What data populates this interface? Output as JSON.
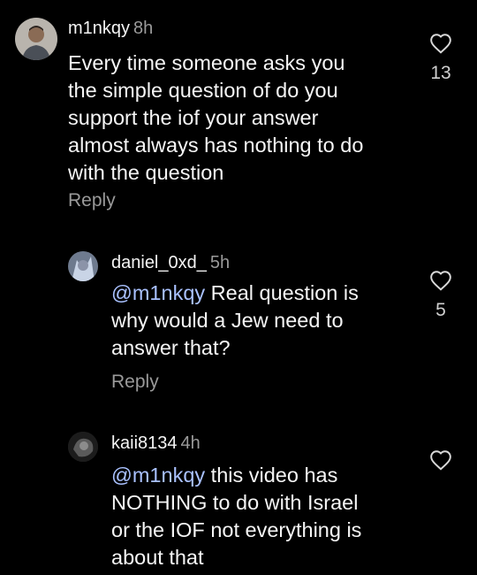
{
  "comments": [
    {
      "username": "m1nkqy",
      "time": "8h",
      "mention": "",
      "text": "Every time someone asks you the simple question of do you support the iof your answer almost always has nothing to do with the question",
      "lines": [
        "Every time someone asks you",
        "the simple question of do you",
        "support the iof your answer",
        "almost always has nothing to do",
        "with the question"
      ],
      "reply_label": "Reply",
      "likes": "13",
      "avatar_icon": "profile-photo-man",
      "heart_icon": "heart-outline-icon"
    },
    {
      "username": "daniel_0xd_",
      "time": "5h",
      "mention": "@m1nkqy",
      "lines": [
        "Real question is",
        "why would a Jew need to",
        "answer that?"
      ],
      "reply_label": "Reply",
      "likes": "5",
      "avatar_icon": "profile-photo-anime",
      "heart_icon": "heart-outline-icon"
    },
    {
      "username": "kaii8134",
      "time": "4h",
      "mention": "@m1nkqy",
      "lines": [
        "this video has",
        "NOTHING to do with Israel",
        "or the IOF not everything is",
        "about that"
      ],
      "likes": "",
      "avatar_icon": "profile-photo-dark",
      "heart_icon": "heart-outline-icon"
    }
  ],
  "colors": {
    "background": "#000000",
    "text": "#f5f5f5",
    "secondary_text": "#9a9a9a",
    "mention": "#a9c1ff"
  }
}
